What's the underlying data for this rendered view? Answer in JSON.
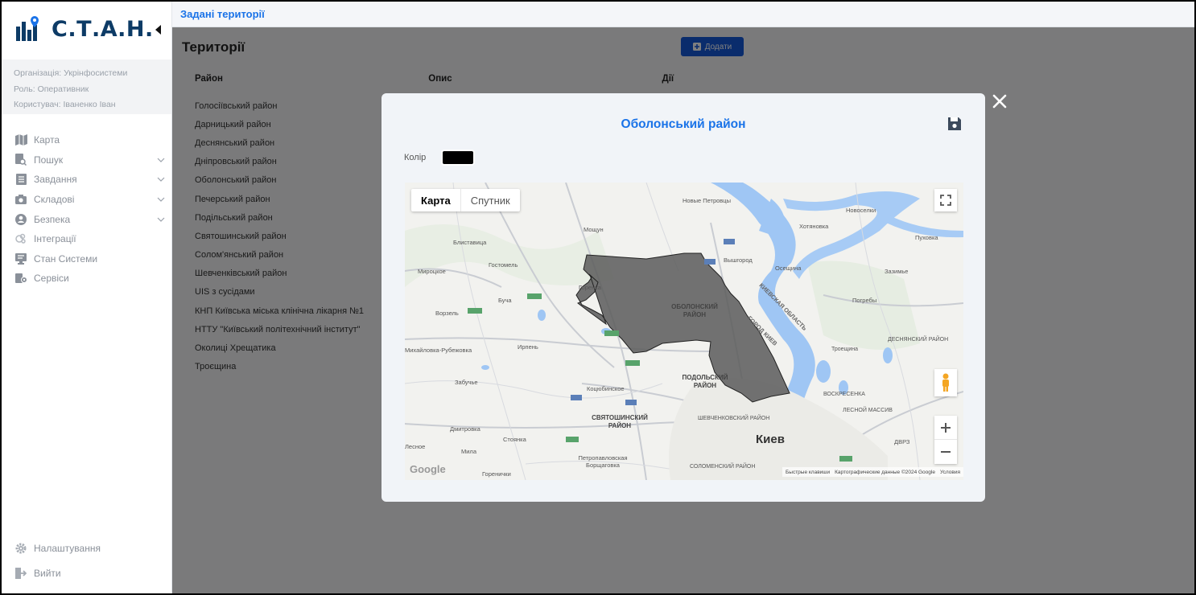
{
  "app": {
    "logo_text": "С.Т.А.Н."
  },
  "user": {
    "organization": "Організація: Укрінфосистеми",
    "role": "Роль: Оперативник",
    "user": "Користувач: Іваненко Іван"
  },
  "nav": {
    "items": [
      {
        "label": "Карта",
        "icon": "map-icon"
      },
      {
        "label": "Пошук",
        "icon": "search-doc-icon"
      },
      {
        "label": "Завдання",
        "icon": "tasks-icon"
      },
      {
        "label": "Складові",
        "icon": "camera-icon"
      },
      {
        "label": "Безпека",
        "icon": "user-shield-icon"
      },
      {
        "label": "Інтеграції",
        "icon": "integrations-icon"
      },
      {
        "label": "Стан Системи",
        "icon": "monitor-icon"
      },
      {
        "label": "Сервіси",
        "icon": "services-icon"
      }
    ],
    "settings": "Налаштування",
    "logout": "Вийти"
  },
  "header": {
    "breadcrumb": "Задані території"
  },
  "page": {
    "title": "Території",
    "add_label": "Додати",
    "columns": [
      "Район",
      "Опис",
      "Дії"
    ],
    "rows": [
      "Голосіївський район",
      "Дарницький район",
      "Деснянський район",
      "Дніпровський район",
      "Оболонський район",
      "Печерський район",
      "Подільський район",
      "Святошинський район",
      "Солом'янський район",
      "Шевченківський район",
      "UIS з сусідами",
      "КНП Київська міська клінічна лікарня №1",
      "НТТУ \"Київський політехнічний інститут\"",
      "Околиці Хрещатика",
      "Троєщина"
    ]
  },
  "modal": {
    "title": "Оболонський район",
    "color_label": "Колір",
    "color_value": "#000000",
    "map": {
      "tab_map": "Карта",
      "tab_satellite": "Спутник",
      "labels": [
        "Новые Петровцы",
        "Новоселки",
        "Хотяновка",
        "Мощун",
        "Пуховка",
        "Блиставица",
        "Гостомель",
        "Вышгород",
        "Осещина",
        "Мироцкое",
        "Зазимье",
        "Ирпень",
        "Буча",
        "Погребы",
        "Ворзель",
        "Горенка",
        "КИЕВСКАЯ ОБЛАСТЬ",
        "ГОРОД КИЕВ",
        "Троещина",
        "Михайловка-Рубежовка",
        "ДЕСНЯНСКИЙ РАЙОН",
        "Забучье",
        "Коцюбинское",
        "ВОСКРЕСЕНКА",
        "ЛЕСНОЙ МАССИВ",
        "Дмитровка",
        "Стоянка",
        "Киев",
        "Мила",
        "ДВРЗ",
        "Петропавловская Борщаговка",
        "Горенички",
        "Лесное"
      ],
      "district_labels": [
        "ОБОЛОНСКИЙ РАЙОН",
        "ПОДОЛЬСКИЙ РАЙОН",
        "СВЯТОШИНСКИЙ РАЙОН",
        "ШЕВЧЕНКОВСКИЙ РАЙОН",
        "СОЛОМЕНСКИЙ РАЙОН"
      ],
      "attribution": [
        "Быстрые клавиши",
        "Картографические данные ©2024 Google",
        "Условия"
      ],
      "google": "Google"
    }
  }
}
